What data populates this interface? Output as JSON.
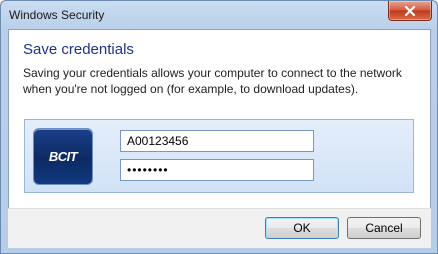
{
  "window": {
    "title": "Windows Security"
  },
  "dialog": {
    "heading": "Save credentials",
    "description": "Saving your credentials allows your computer to connect to the network when you're not logged on (for example, to download updates)."
  },
  "credential_tile": {
    "logo_text": "BCIT",
    "username_value": "A00123456",
    "password_value": "••••••••"
  },
  "buttons": {
    "ok_label": "OK",
    "cancel_label": "Cancel"
  },
  "icons": {
    "close": "close-icon"
  }
}
